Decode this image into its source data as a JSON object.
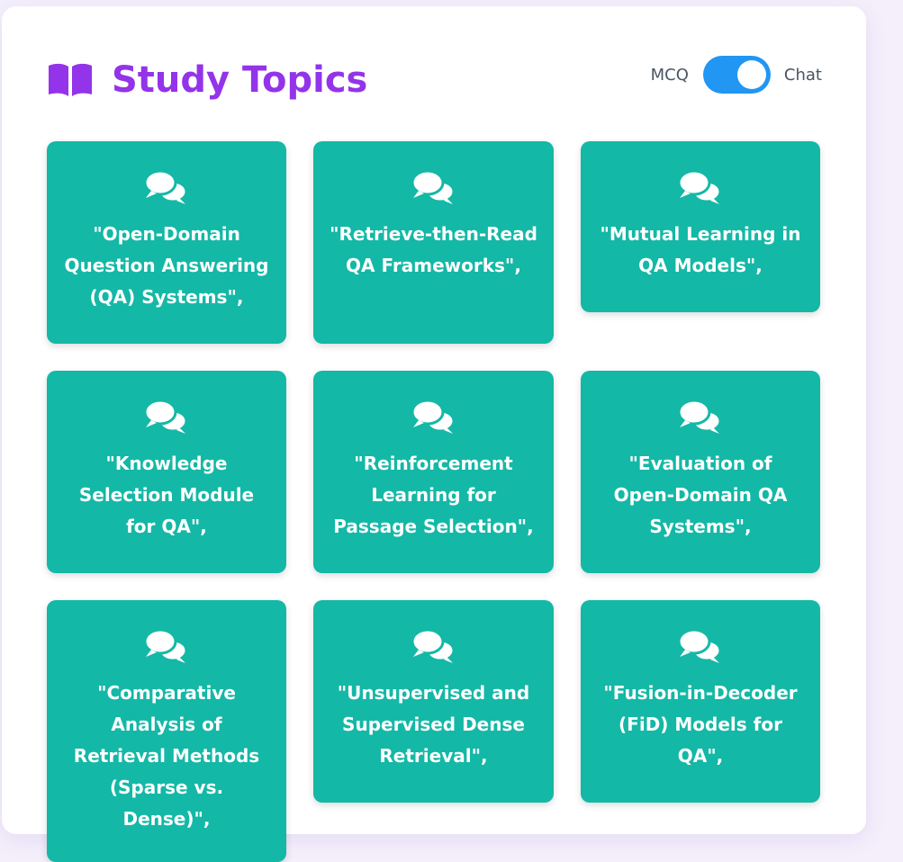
{
  "header": {
    "title": "Study Topics",
    "title_icon": "book-open-icon",
    "title_color": "#9333ea"
  },
  "mode_toggle": {
    "left_label": "MCQ",
    "right_label": "Chat",
    "selected": "Chat",
    "track_color": "#2196f3"
  },
  "card_color": "#14b8a6",
  "card_icon": "comments-icon",
  "topics": [
    "\"Open-Domain Question Answering (QA) Systems\",",
    "\"Retrieve-then-Read QA Frameworks\",",
    "\"Mutual Learning in QA Models\",",
    "\"Knowledge Selection Module for QA\",",
    "\"Reinforcement Learning for Passage Selection\",",
    "\"Evaluation of Open-Domain QA Systems\",",
    "\"Comparative Analysis of Retrieval Methods (Sparse vs. Dense)\",",
    "\"Unsupervised and Supervised Dense Retrieval\",",
    "\"Fusion-in-Decoder (FiD) Models for QA\","
  ]
}
